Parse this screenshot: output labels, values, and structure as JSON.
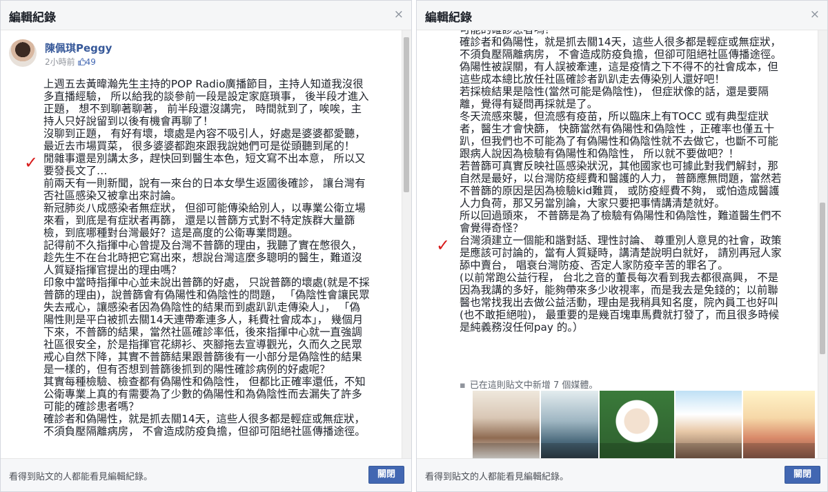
{
  "dialog": {
    "title": "編輯紀錄",
    "close_icon": "×",
    "footer_note": "看得到貼文的人都能看見編輯紀錄。",
    "close_button": "關閉"
  },
  "author": {
    "name": "陳佩琪Peggy",
    "time": "2小時前",
    "likes_icon": "thumbs-up-icon",
    "likes_count": "49"
  },
  "checkmark": "✓",
  "left_post_text": "上週五去黃暐瀚先生主持的POP Radio廣播節目，主持人知道我沒很\n多直播經驗， 所以給我的談參前一段是設定家庭瑣事， 後半段才進入\n正題， 想不到聊著聊著， 前半段還沒講完， 時間就到了，唉唉，主\n持人只好說留到以後有機會再聊了！\n沒聊到正題， 有好有壞，壞處是內容不吸引人，好處是婆婆都愛聽，\n最近去市場買菜， 很多婆婆都跑來跟我說她們可是從頭聽到尾的！\n閒雜事還是別講太多，趕快回到醫生本色，短文寫不出本意， 所以又\n要發長文了…\n前兩天有一則新聞，說有一來台的日本女學生返國後確診， 讓台灣有\n否社區感染又被拿出來討論。\n新冠肺炎八成感染者無症狀， 但卻可能傳染給別人，以專業公衛立場\n來看，到底是有症狀者再篩， 還是以普篩方式對不特定族群大量篩\n檢，到底哪種對台灣最好？這是高度的公衛專業問題。\n記得前不久指揮中心曾提及台灣不普篩的理由，我聽了實在憋很久，\n趁先生不在台北時把它寫出來，想說台灣這麼多聰明的醫生，難道沒\n人質疑指揮官提出的理由嗎？\n印象中當時指揮中心並未說出普篩的好處， 只說普篩的壞處(就是不採\n普篩的理由)，說普篩會有偽陽性和偽陰性的問題， 「偽陰性會讓民眾\n失去戒心，讓感染者因為偽陰性的結果而到處趴趴走傳染人」， 「偽\n陽性則是平白被抓去關14天連帶牽連多人，耗費社會成本」， 幾個月\n下來，不普篩的結果，當然社區確診率低，後來指揮中心就一直強調\n社區很安全，於是指揮官花綁衫、夾腳拖去宣導觀光，久而久之民眾\n戒心自然下降，其實不普篩結果跟普篩後有一小部分是偽陰性的結果\n是一樣的，但有否想到普篩後抓到的陽性確診病例的好處呢？\n其實每種檢驗、檢查都有偽陽性和偽陰性， 但都比正確率還低，不知\n公衛專業上真的有需要為了少數的偽陽性和為偽陰性而去漏失了許多\n可能的確診患者嗎？\n確診者和偽陽性，就是抓去關14天，這些人很多都是輕症或無症狀，\n不須負壓隔離病房， 不會造成防疫負擔，但卻可阻絕社區傳播途徑。",
  "right_post_text": "可能的確診患者嗎？\n確診者和偽陽性，就是抓去關14天，這些人很多都是輕症或無症狀，\n不須負壓隔離病房， 不會造成防疫負擔，但卻可阻絕社區傳播途徑。\n偽陽性被誤關，有人誤被牽連，這是疫情之下不得不的社會成本，但\n這些成本總比放任社區確診者趴趴走去傳染別人還好吧！\n若採檢結果是陰性(當然可能是偽陰性)， 但症狀像的話，還是要隔\n離，覺得有疑問再採就是了。\n冬天流感來襲，但流感有疫苗，所以臨床上有TOCC 或有典型症狀\n者，醫生才會快篩， 快篩當然有偽陽性和偽陰性 ，正確率也僅五十\n趴，但我們也不可能為了有偽陽性和偽陰性就不去做它，也斷不可能\n跟病人說因為檢驗有偽陽性和偽陰性， 所以就不要做吧？！\n若普篩可真實反映社區感染狀況，其他國家也可據此對我們解封，那\n自然是最好，以台灣防疫經費和醫護的人力， 普篩應無問題，當然若\n不普篩的原因是因為檢驗kid難買， 或防疫經費不夠， 或怕造成醫護\n人力負荷，那又另當別論，大家只要把事情講清楚就好。\n所以回過頭來， 不普篩是為了檢驗有偽陽性和偽陰性，難道醫生們不\n會覺得奇怪？\n台灣須建立一個能和諧對話、理性討論、 尊重別人意見的社會，政策\n是應該可討論的，當有人質疑時，講清楚說明白就好， 請別再冠人家\n舔中賣台， 唱衰台灣防疫、否定人家防疫辛苦的罪名了。\n(以前常跑公益行程， 台北之音的董長每次看到我去都很高興， 不是\n因為我講的多好，能夠帶來多少收視率，而是我去是免錢的；以前聯\n醫也常找我出去做公益活動，理由是我稍具知名度，院內員工也好叫\n(也不敢拒絕啦)， 最重要的是幾百塊車馬費就打發了，而且很多時候\n是純義務沒任何pay 的。）",
  "media": {
    "bullet": "▪",
    "note": "已在這則貼文中新增 7 個媒體。"
  },
  "colors": {
    "link": "#365899",
    "button": "#4267b2",
    "check_red": "#d81b1b"
  }
}
